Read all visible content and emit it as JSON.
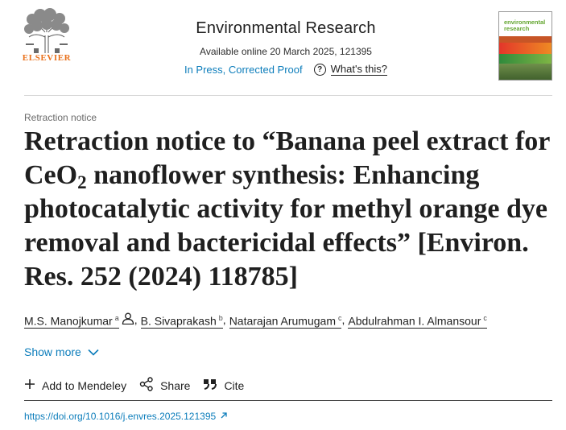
{
  "header": {
    "publisher_logo_icon": "elsevier-tree-logo",
    "publisher_name": "ELSEVIER",
    "journal_title": "Environmental Research",
    "availability": "Available online 20 March 2025, 121395",
    "status_link": "In Press, Corrected Proof",
    "help_icon": "question-circle-icon",
    "help_link": "What's this?",
    "cover": {
      "label_line1": "environmental",
      "label_line2": "research"
    }
  },
  "article": {
    "type": "Retraction notice",
    "title_part1": "Retraction notice to “Banana peel extract for CeO",
    "title_sub": "2",
    "title_part2": " nanoflower synthesis: Enhancing photocatalytic activity for methyl orange dye removal and bactericidal effects” [Environ. Res. 252 (2024) 118785]",
    "authors": [
      {
        "name": "M.S. Manojkumar",
        "sup": "a",
        "icon": "person-icon"
      },
      {
        "name": "B. Sivaprakash",
        "sup": "b"
      },
      {
        "name": "Natarajan Arumugam",
        "sup": "c"
      },
      {
        "name": "Abdulrahman I. Almansour",
        "sup": "c"
      }
    ],
    "separator": ",",
    "show_more": "Show more",
    "actions": [
      {
        "label": "Add to Mendeley",
        "icon": "plus-icon"
      },
      {
        "label": "Share",
        "icon": "share-icon"
      },
      {
        "label": "Cite",
        "icon": "quote-icon"
      }
    ],
    "doi": "https://doi.org/10.1016/j.envres.2025.121395",
    "doi_icon": "external-link-icon"
  },
  "colors": {
    "link_blue": "#0c7dbb",
    "elsevier_orange": "#e9711c",
    "text": "#1f1f1f"
  }
}
